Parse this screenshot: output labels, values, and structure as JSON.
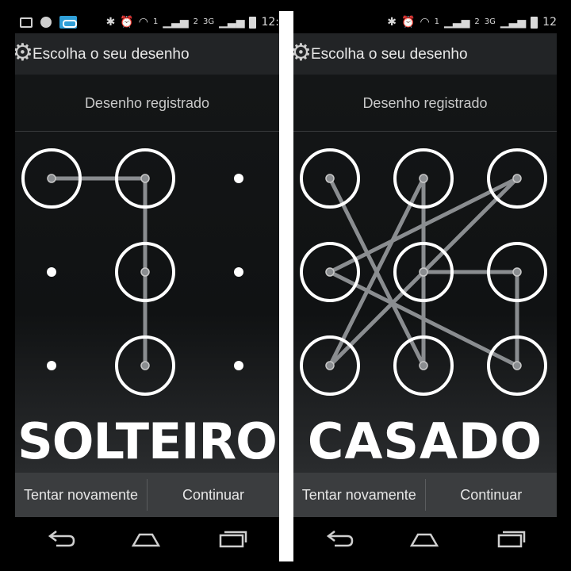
{
  "panels": [
    {
      "status_time": "12:",
      "network": "3G",
      "sim1": "1",
      "sim2": "2",
      "title": "Escolha o seu desenho",
      "header": "Desenho registrado",
      "caption": "SOLTEIRO",
      "retry_label": "Tentar novamente",
      "continue_label": "Continuar",
      "pattern": [
        1,
        2,
        5,
        8
      ],
      "active_dots": [
        1,
        2,
        5,
        8
      ]
    },
    {
      "status_time": "12",
      "network": "3G",
      "sim1": "1",
      "sim2": "2",
      "title": "Escolha o seu desenho",
      "header": "Desenho registrado",
      "caption": "CASADO",
      "retry_label": "Tentar novamente",
      "continue_label": "Continuar",
      "pattern": [
        1,
        8,
        2,
        7,
        3,
        4,
        9,
        6,
        5
      ],
      "active_dots": [
        1,
        2,
        3,
        4,
        5,
        6,
        7,
        8,
        9
      ]
    }
  ],
  "colors": {
    "background": "#000000",
    "line": "#8a8d90",
    "ring": "#ffffff",
    "separator": "#ffffff"
  }
}
